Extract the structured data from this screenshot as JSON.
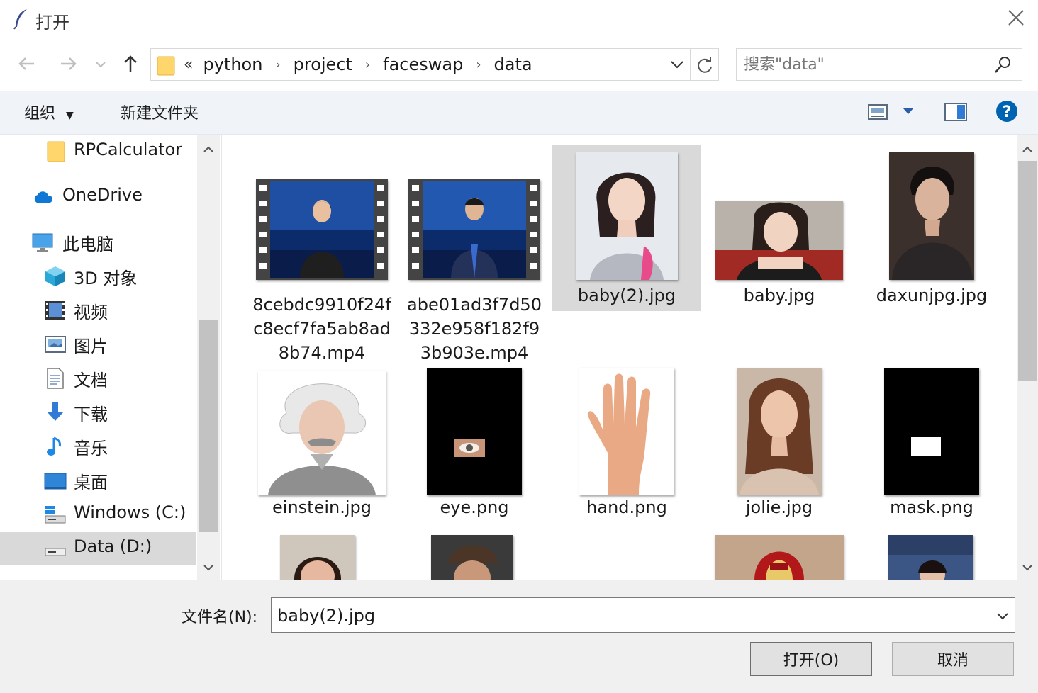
{
  "window": {
    "title": "打开",
    "close_icon": "close-icon",
    "app_icon": "feather-icon"
  },
  "nav": {
    "breadcrumb_lead": "«",
    "breadcrumb": [
      "python",
      "project",
      "faceswap",
      "data"
    ],
    "search_placeholder": "搜索\"data\""
  },
  "toolbar": {
    "organize": "组织",
    "new_folder": "新建文件夹"
  },
  "sidebar": {
    "items": [
      {
        "label": "RPCalculator",
        "icon": "folder-icon"
      },
      {
        "label": "OneDrive",
        "icon": "cloud-icon"
      },
      {
        "label": "此电脑",
        "icon": "computer-icon"
      },
      {
        "label": "3D 对象",
        "icon": "cube-icon"
      },
      {
        "label": "视频",
        "icon": "video-icon"
      },
      {
        "label": "图片",
        "icon": "pictures-icon"
      },
      {
        "label": "文档",
        "icon": "document-icon"
      },
      {
        "label": "下载",
        "icon": "download-icon"
      },
      {
        "label": "音乐",
        "icon": "music-icon"
      },
      {
        "label": "桌面",
        "icon": "desktop-icon"
      },
      {
        "label": "Windows (C:)",
        "icon": "drive-icon"
      },
      {
        "label": "Data (D:)",
        "icon": "drive-icon"
      }
    ],
    "selected": "Data (D:)"
  },
  "files": [
    {
      "name": "8cebdc9910f24fc8ecf7fa5ab8ad8b74.mp4",
      "kind": "video"
    },
    {
      "name": "abe01ad3f7d50332e958f182f93b903e.mp4",
      "kind": "video"
    },
    {
      "name": "baby(2).jpg",
      "kind": "image",
      "selected": true
    },
    {
      "name": "baby.jpg",
      "kind": "image"
    },
    {
      "name": "daxunjpg.jpg",
      "kind": "image"
    },
    {
      "name": "einstein.jpg",
      "kind": "image"
    },
    {
      "name": "eye.png",
      "kind": "image"
    },
    {
      "name": "hand.png",
      "kind": "image"
    },
    {
      "name": "jolie.jpg",
      "kind": "image"
    },
    {
      "name": "mask.png",
      "kind": "image"
    }
  ],
  "footer": {
    "filename_label": "文件名(N):",
    "filename_value": "baby(2).jpg",
    "open_button": "打开(O)",
    "cancel_button": "取消"
  },
  "colors": {
    "selection": "#d9d9d9",
    "help_blue": "#0063b1",
    "folder_yellow": "#ffd66b",
    "onedrive_blue": "#0f78d4"
  }
}
